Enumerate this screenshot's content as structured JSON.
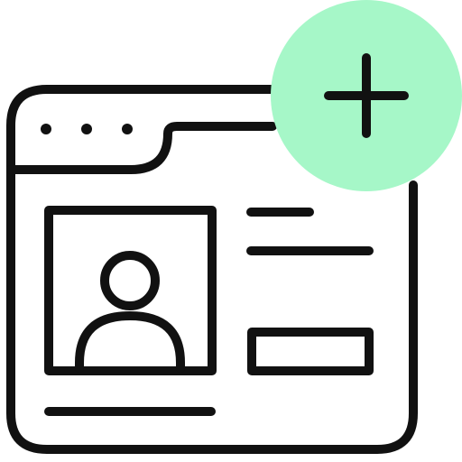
{
  "icon": {
    "name": "add-profile-web-page-icon",
    "colors": {
      "stroke": "#111111",
      "background": "#ffffff",
      "accent": "#a6f7c8"
    },
    "parts": [
      "browser-window-icon",
      "window-dots-icon",
      "browser-tab-icon",
      "profile-photo-icon",
      "user-avatar-icon",
      "text-lines-icon",
      "input-field-icon",
      "add-badge-icon",
      "plus-icon"
    ]
  }
}
